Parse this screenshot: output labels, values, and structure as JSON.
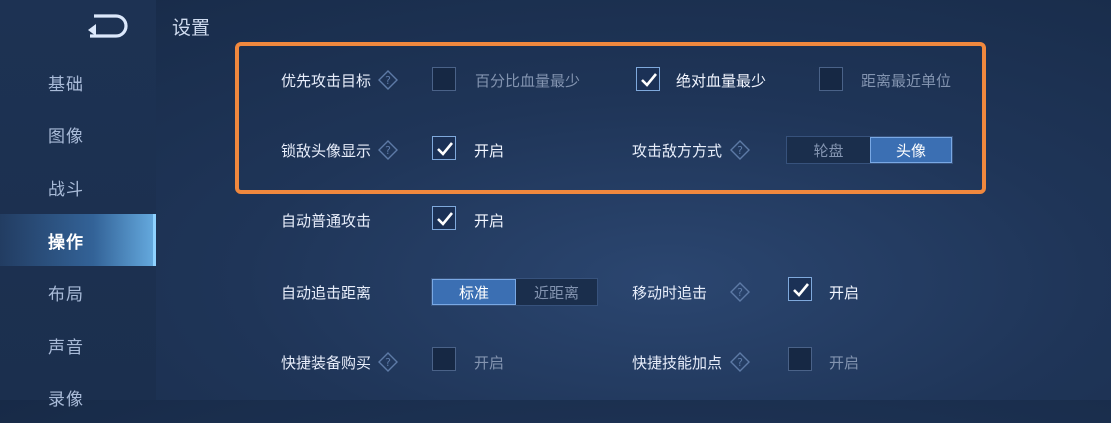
{
  "header": {
    "title": "设置"
  },
  "sidebar": {
    "items": [
      {
        "label": "基础"
      },
      {
        "label": "图像"
      },
      {
        "label": "战斗"
      },
      {
        "label": "操作"
      },
      {
        "label": "布局"
      },
      {
        "label": "声音"
      },
      {
        "label": "录像"
      }
    ],
    "active": "操作"
  },
  "settings": {
    "priority_target": {
      "label": "优先攻击目标",
      "options": [
        {
          "label": "百分比血量最少",
          "checked": false
        },
        {
          "label": "绝对血量最少",
          "checked": true
        },
        {
          "label": "距离最近单位",
          "checked": false
        }
      ]
    },
    "lock_avatar": {
      "label": "锁敌头像显示",
      "option": "开启",
      "checked": true
    },
    "attack_enemy_mode": {
      "label": "攻击敌方方式",
      "segments": [
        "轮盘",
        "头像"
      ],
      "selected": "头像"
    },
    "auto_attack": {
      "label": "自动普通攻击",
      "option": "开启",
      "checked": true
    },
    "auto_chase_distance": {
      "label": "自动追击距离",
      "segments": [
        "标准",
        "近距离"
      ],
      "selected": "标准"
    },
    "move_chase": {
      "label": "移动时追击",
      "option": "开启",
      "checked": true
    },
    "quick_buy": {
      "label": "快捷装备购买",
      "option": "开启",
      "checked": false
    },
    "quick_skill": {
      "label": "快捷技能加点",
      "option": "开启",
      "checked": false
    }
  },
  "colors": {
    "highlight": "#f0883e",
    "accent": "#3b6fb3",
    "background": "#1f3558"
  },
  "icons": {
    "back": "back-arrow-icon",
    "help": "question-diamond-icon",
    "check": "checkmark-icon"
  }
}
